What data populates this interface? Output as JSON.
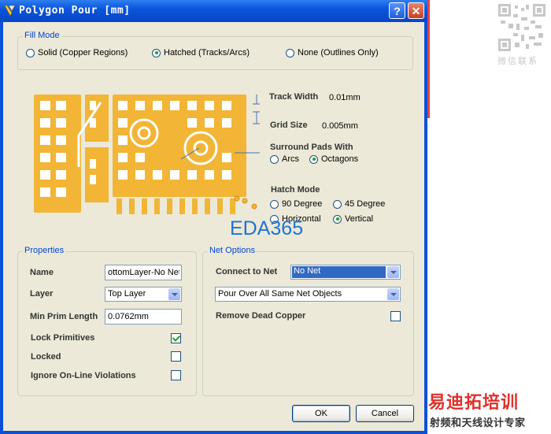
{
  "window": {
    "title": "Polygon Pour [mm]",
    "help_label": "?",
    "close_label": "✕"
  },
  "fill_mode": {
    "legend": "Fill Mode",
    "options": [
      {
        "label": "Solid (Copper Regions)",
        "selected": false
      },
      {
        "label": "Hatched (Tracks/Arcs)",
        "selected": true
      },
      {
        "label": "None (Outlines Only)",
        "selected": false
      }
    ]
  },
  "preview": {
    "track_width_label": "Track Width",
    "track_width_value": "0.01mm",
    "grid_size_label": "Grid Size",
    "grid_size_value": "0.005mm",
    "surround_label": "Surround Pads With",
    "surround_options": [
      {
        "label": "Arcs",
        "selected": false
      },
      {
        "label": "Octagons",
        "selected": true
      }
    ],
    "hatch_label": "Hatch Mode",
    "hatch_options": [
      {
        "label": "90 Degree",
        "selected": false
      },
      {
        "label": "45 Degree",
        "selected": false
      },
      {
        "label": "Horizontal",
        "selected": false
      },
      {
        "label": "Vertical",
        "selected": true
      }
    ],
    "copper_color": "#f2b535",
    "watermark": "EDA365"
  },
  "properties": {
    "legend": "Properties",
    "name_label": "Name",
    "name_value": "ottomLayer-No Net",
    "layer_label": "Layer",
    "layer_value": "Top Layer",
    "min_prim_label": "Min Prim Length",
    "min_prim_value": "0.0762mm",
    "lock_primitives_label": "Lock Primitives",
    "lock_primitives_checked": true,
    "locked_label": "Locked",
    "locked_checked": false,
    "ignore_violations_label": "Ignore On-Line Violations",
    "ignore_violations_checked": false
  },
  "net_options": {
    "legend": "Net Options",
    "connect_label": "Connect to Net",
    "connect_value": "No Net",
    "pour_value": "Pour Over All Same Net Objects",
    "remove_dead_label": "Remove Dead Copper",
    "remove_dead_checked": false
  },
  "buttons": {
    "ok": "OK",
    "cancel": "Cancel"
  },
  "side": {
    "qr_caption": "微信联系",
    "brand_title": "易迪拓培训",
    "brand_sub": "射频和天线设计专家"
  }
}
